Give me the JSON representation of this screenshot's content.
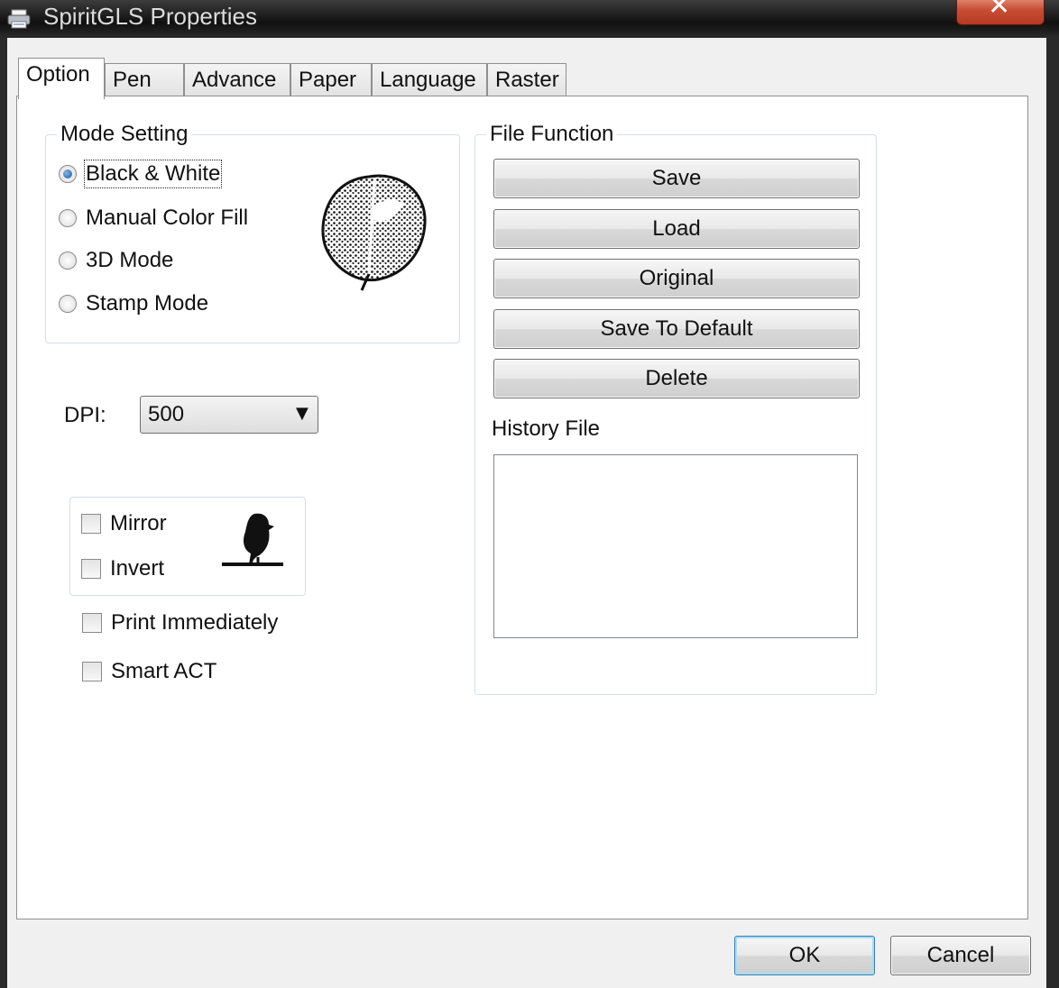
{
  "window": {
    "title": "SpiritGLS Properties",
    "close_glyph": "✕"
  },
  "tabs": [
    {
      "label": "Option",
      "active": true
    },
    {
      "label": "Pen",
      "active": false
    },
    {
      "label": "Advance",
      "active": false
    },
    {
      "label": "Paper",
      "active": false
    },
    {
      "label": "Language",
      "active": false
    },
    {
      "label": "Raster",
      "active": false
    }
  ],
  "mode_setting": {
    "legend": "Mode Setting",
    "options": [
      {
        "label": "Black & White",
        "checked": true
      },
      {
        "label": "Manual Color Fill",
        "checked": false
      },
      {
        "label": "3D Mode",
        "checked": false
      },
      {
        "label": "Stamp Mode",
        "checked": false
      }
    ],
    "preview_icon": "leaf-image"
  },
  "dpi": {
    "label": "DPI:",
    "value": "500",
    "arrow": "▼"
  },
  "effects": {
    "mirror_label": "Mirror",
    "invert_label": "Invert",
    "preview_icon": "bird-image"
  },
  "print_immediately_label": "Print Immediately",
  "smart_act_label": "Smart ACT",
  "file_function": {
    "legend": "File Function",
    "buttons": [
      "Save",
      "Load",
      "Original",
      "Save To Default",
      "Delete"
    ],
    "history_label": "History File"
  },
  "footer": {
    "ok_label": "OK",
    "cancel_label": "Cancel"
  },
  "colors": {
    "titlebar": "#101010",
    "close_button": "#c74d33",
    "radio_selected": "#1c5a9c",
    "ok_border": "#3c7fb1"
  }
}
